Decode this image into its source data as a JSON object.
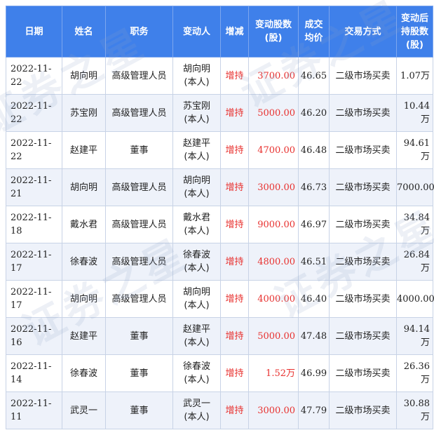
{
  "colors": {
    "header_bg": "#3f80ea",
    "increase_text": "#e8312f",
    "stripe_bg": "#eef2fa"
  },
  "watermark": "证券之星",
  "headers": [
    {
      "key": "date",
      "lines": [
        "日期"
      ]
    },
    {
      "key": "name",
      "lines": [
        "姓名"
      ]
    },
    {
      "key": "position",
      "lines": [
        "职务"
      ]
    },
    {
      "key": "changer",
      "lines": [
        "变动人"
      ]
    },
    {
      "key": "direction",
      "lines": [
        "增减"
      ]
    },
    {
      "key": "change_shares",
      "lines": [
        "变动股数",
        "(股)"
      ]
    },
    {
      "key": "avg_price",
      "lines": [
        "成交",
        "均价"
      ]
    },
    {
      "key": "method",
      "lines": [
        "交易方式"
      ]
    },
    {
      "key": "holding_after",
      "lines": [
        "变动后",
        "持股数",
        "(股)"
      ]
    }
  ],
  "rows": [
    {
      "date": "2022-11-22",
      "name": "胡向明",
      "position": "高级管理人员",
      "changer": [
        "胡向明",
        "(本人)"
      ],
      "direction": "增持",
      "change_shares": "3700.00",
      "avg_price": "46.65",
      "method": "二级市场买卖",
      "holding_after": "1.07万"
    },
    {
      "date": "2022-11-22",
      "name": "苏宝刚",
      "position": "高级管理人员",
      "changer": [
        "苏宝刚",
        "(本人)"
      ],
      "direction": "增持",
      "change_shares": "5000.00",
      "avg_price": "46.20",
      "method": "二级市场买卖",
      "holding_after": "10.44万"
    },
    {
      "date": "2022-11-22",
      "name": "赵建平",
      "position": "董事",
      "changer": [
        "赵建平",
        "(本人)"
      ],
      "direction": "增持",
      "change_shares": "4700.00",
      "avg_price": "46.48",
      "method": "二级市场买卖",
      "holding_after": "94.61万"
    },
    {
      "date": "2022-11-21",
      "name": "胡向明",
      "position": "高级管理人员",
      "changer": [
        "胡向明",
        "(本人)"
      ],
      "direction": "增持",
      "change_shares": "3000.00",
      "avg_price": "46.73",
      "method": "二级市场买卖",
      "holding_after": "7000.00"
    },
    {
      "date": "2022-11-18",
      "name": "戴水君",
      "position": "高级管理人员",
      "changer": [
        "戴水君",
        "(本人)"
      ],
      "direction": "增持",
      "change_shares": "9000.00",
      "avg_price": "46.97",
      "method": "二级市场买卖",
      "holding_after": "34.84万"
    },
    {
      "date": "2022-11-17",
      "name": "徐春波",
      "position": "高级管理人员",
      "changer": [
        "徐春波",
        "(本人)"
      ],
      "direction": "增持",
      "change_shares": "4800.00",
      "avg_price": "46.51",
      "method": "二级市场买卖",
      "holding_after": "26.84万"
    },
    {
      "date": "2022-11-17",
      "name": "胡向明",
      "position": "高级管理人员",
      "changer": [
        "胡向明",
        "(本人)"
      ],
      "direction": "增持",
      "change_shares": "4000.00",
      "avg_price": "46.40",
      "method": "二级市场买卖",
      "holding_after": "4000.00"
    },
    {
      "date": "2022-11-16",
      "name": "赵建平",
      "position": "董事",
      "changer": [
        "赵建平",
        "(本人)"
      ],
      "direction": "增持",
      "change_shares": "5000.00",
      "avg_price": "47.48",
      "method": "二级市场买卖",
      "holding_after": "94.14万"
    },
    {
      "date": "2022-11-14",
      "name": "徐春波",
      "position": "董事",
      "changer": [
        "徐春波",
        "(本人)"
      ],
      "direction": "增持",
      "change_shares": "1.52万",
      "avg_price": "46.99",
      "method": "二级市场买卖",
      "holding_after": "26.36万"
    },
    {
      "date": "2022-11-11",
      "name": "武灵一",
      "position": "董事",
      "changer": [
        "武灵一",
        "(本人)"
      ],
      "direction": "增持",
      "change_shares": "3000.00",
      "avg_price": "47.79",
      "method": "二级市场买卖",
      "holding_after": "30.88万"
    }
  ]
}
